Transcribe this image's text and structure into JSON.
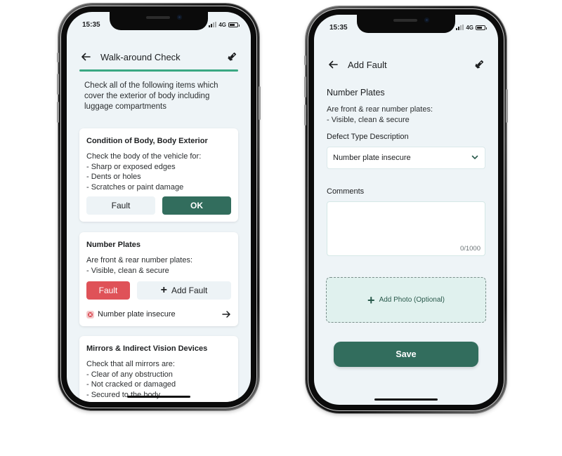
{
  "colors": {
    "primary": "#326d5d",
    "progress": "#3aa883",
    "fault": "#df5258",
    "screen_bg": "#eef4f7"
  },
  "walkaround_screen": {
    "status_bar": {
      "time": "15:35",
      "network": "4G"
    },
    "header": {
      "title": "Walk-around Check",
      "back_icon": "arrow-left-icon",
      "action_icon": "flashlight-icon"
    },
    "progress_percent": 100,
    "intro": "Check all of the following items which cover the exterior of body including luggage compartments",
    "cards": [
      {
        "title": "Condition of Body, Body Exterior",
        "description": "Check the body of the vehicle for:\n- Sharp or exposed edges\n- Dents or holes\n- Scratches or paint damage",
        "fault_label": "Fault",
        "ok_label": "OK",
        "selected": "OK"
      },
      {
        "title": "Number Plates",
        "description": "Are front & rear number plates:\n- Visible, clean & secure",
        "fault_label": "Fault",
        "add_fault_label": "Add Fault",
        "selected": "Fault",
        "faults": [
          {
            "label": "Number plate insecure"
          }
        ]
      },
      {
        "title": "Mirrors & Indirect Vision Devices",
        "description": "Check that all mirrors are:\n- Clear of any obstruction\n- Not cracked or damaged\n- Secured to the body"
      }
    ]
  },
  "add_fault_screen": {
    "status_bar": {
      "time": "15:35",
      "network": "4G"
    },
    "header": {
      "title": "Add Fault",
      "back_icon": "arrow-left-icon",
      "action_icon": "flashlight-icon"
    },
    "item_title": "Number Plates",
    "item_description": "Are front & rear number plates:\n- Visible, clean & secure",
    "defect_label": "Defect Type Description",
    "defect_value": "Number plate insecure",
    "comments_label": "Comments",
    "comments_value": "",
    "comments_counter": "0/1000",
    "add_photo_label": "Add Photo (Optional)",
    "save_label": "Save"
  }
}
